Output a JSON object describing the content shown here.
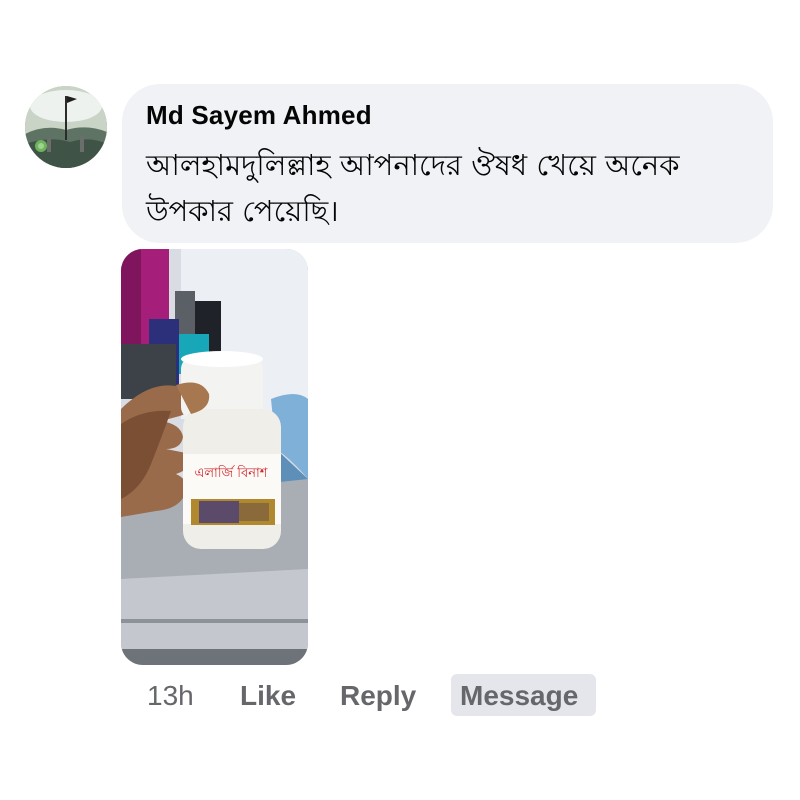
{
  "comment": {
    "author": "Md Sayem Ahmed",
    "text": "আলহামদুলিল্লাহ  আপনাদের ঔষধ খেয়ে অনেক উপকার পেয়েছি।",
    "bottle_label": "এলার্জি বিনাশ",
    "actions": {
      "time": "13h",
      "like": "Like",
      "reply": "Reply",
      "message": "Message"
    }
  },
  "colors": {
    "bubble_bg": "#f0f2f5",
    "action_text": "#65676b",
    "message_button_bg": "#e4e6eb"
  }
}
